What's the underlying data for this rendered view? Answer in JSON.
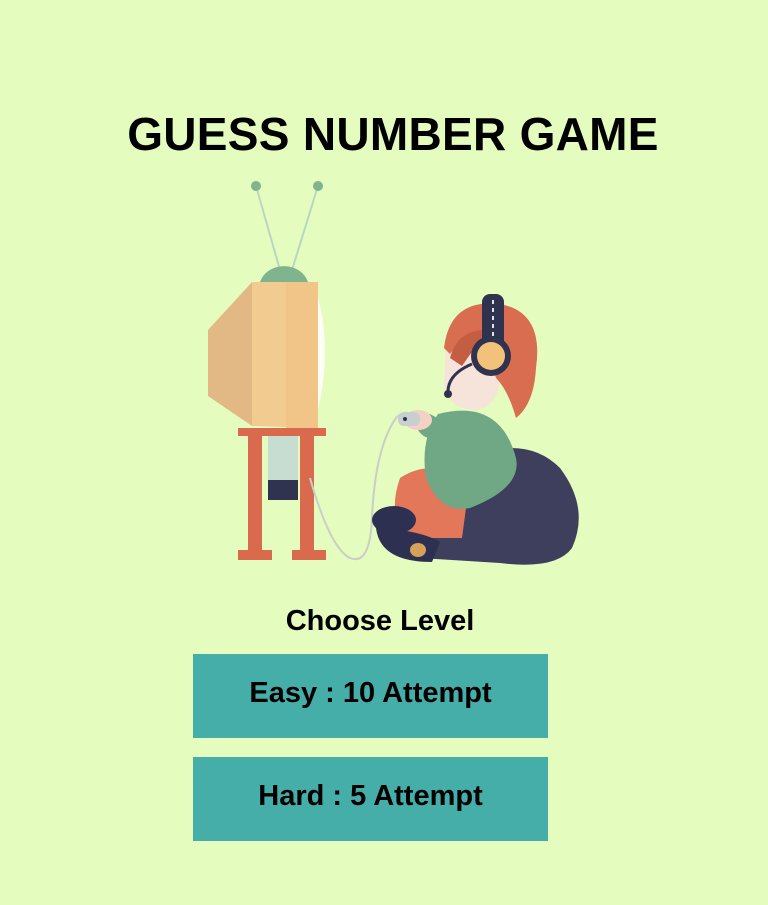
{
  "game": {
    "title": "GUESS NUMBER GAME",
    "choose_label": "Choose Level",
    "levels": [
      {
        "label": "Easy : 10 Attempt"
      },
      {
        "label": "Hard : 5 Attempt"
      }
    ]
  },
  "colors": {
    "background": "#e5fcbf",
    "button": "#45aea8",
    "text": "#000000"
  },
  "illustration": {
    "subject": "gamer-with-headphones-playing-retro-tv-icon"
  }
}
